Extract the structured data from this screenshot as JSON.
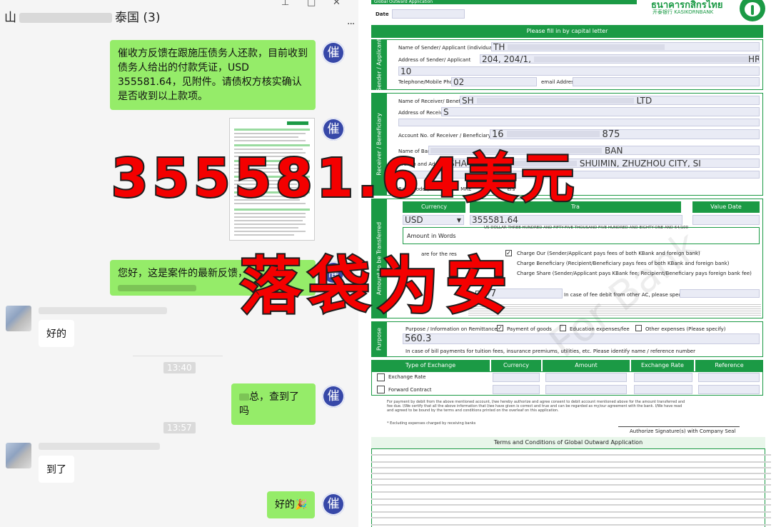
{
  "chat": {
    "title": "泰国 (3)",
    "title_prefix": "山",
    "window_controls": [
      "⊥",
      "□",
      "✕"
    ],
    "more_label": "...",
    "messages": [
      {
        "side": "out",
        "avatar": "催",
        "text": "催收方反馈在跟施压债务人还款，目前收到债务人给出的付款凭证，USD 355581.64，见附件。请债权方核实确认是否收到以上款项。"
      },
      {
        "side": "out",
        "avatar": "催",
        "type": "image"
      },
      {
        "side": "out",
        "avatar": "催",
        "text": "您好，这是案件的最新反馈，"
      },
      {
        "side": "in",
        "text": "好的"
      },
      {
        "side": "out",
        "avatar": "催",
        "text": "总，查到了吗"
      },
      {
        "side": "in",
        "text": "到了"
      },
      {
        "side": "out",
        "avatar": "催",
        "text": "好的🎉"
      }
    ],
    "timestamps": [
      "13:40",
      "13:57"
    ]
  },
  "form": {
    "header_title": "Global Outward Application",
    "bank_name_th": "ธนาคารกสิกรไทย",
    "bank_name_en": "开泰银行 KASIKORNBANK",
    "date_label": "Date",
    "instruction": "Please fill in by capital letter",
    "sender_section": "Sender / Applicant",
    "sender_name_label": "Name of Sender/ Applicant (individual/ juristic)",
    "sender_name_value": "TH",
    "sender_address_label": "Address of Sender/ Applicant",
    "sender_address_value": "204, 204/1,",
    "sender_address_extra": "HRA",
    "sender_address_line2": "10",
    "sender_phone_label": "Telephone/Mobile Phone",
    "sender_phone_value": "02",
    "email_label": "email Address",
    "receiver_section": "Receiver / Beneficiary",
    "receiver_name_label": "Name of Receiver/ Beneficiary",
    "receiver_name_value": "SH",
    "receiver_name_suffix": "LTD",
    "receiver_address_label": "Address of Receiver",
    "receiver_address_value": "S",
    "account_label": "Account No. of Receiver / Beneficiary / IBAN",
    "account_value_start": "16",
    "account_value_end": "875",
    "bank_label": "Name of Bank",
    "bank_value_end": "BAN",
    "branch_label": "Branch and Address of Bank",
    "branch_value": "SHA",
    "branch_value_end": "SHUIMIN, ZHUZHOU CITY, SI",
    "bank_code_label": "Bank Code (S",
    "bank_code_extra": "MRE",
    "bank_code_tail": "ers",
    "amount_section": "Amount to be Transferred",
    "currency_header": "Currency",
    "transfer_header": "Tra",
    "value_date_header": "Value Date",
    "currency_value": "USD",
    "amount_value": "355581.64",
    "amount_words_label": "Amount in Words",
    "amount_words_value": "US DOLLAR THREE HUNDRED AND FIFTY-FIVE THOUSAND FIVE HUNDRED AND EIGHTY-ONE AND 64/100",
    "charges_label": "are for the res",
    "charge_our": "Charge Our (Sender/Applicant pays fees of both KBank and foreign bank)",
    "charge_ben": "Charge Beneficiary (Recipient/Beneficiary pays fees of both KBank and foreign bank)",
    "charge_share": "Charge Share (Sender/Applicant pays KBank fee; Recipient/Beneficiary pays foreign bank fee)",
    "debit_account_value": "7",
    "debit_other_label": "In case of fee debit from other AC, please specify AC No.",
    "purpose_section": "Purpose",
    "purpose_label": "Purpose / Information on Remittance",
    "purpose_goods": "Payment of goods",
    "purpose_edu": "Education expenses/fee",
    "purpose_other": "Other expenses (Please specify)",
    "purpose_value": "560.3",
    "purpose_note": "In case of bill payments for tuition fees, insurance premiums, utilities, etc. Please identify name / reference number",
    "fx_headers": [
      "Type of Exchange",
      "Currency",
      "Amount",
      "Exchange Rate",
      "Reference"
    ],
    "fx_rows": [
      "Exchange Rate",
      "Forward Contract"
    ],
    "declaration": "For payment by debit from the above mentioned account, I/we hereby authorize and agree consent to debit account mentioned above for the amount transferred and fee due. I/We certify that all the above information that I/we have given is correct and true and can be regarded as my/our agreement with the bank. I/We have read and agreed to be bound by the terms and conditions printed on the overleaf on this application.",
    "excluding_note": "* Excluding expenses charged by receiving banks",
    "signature_label": "Authorize Signature(s) with Company Seal",
    "terms_title": "Terms and Conditions of Global Outward Application",
    "watermark": "For Bank"
  },
  "overlay": {
    "amount_text": "355581.64美元",
    "status_text": "落袋为安"
  },
  "colors": {
    "wechat_green": "#95ec69",
    "kbank_green": "#1b9a45",
    "overlay_red": "#f40000",
    "avatar_blue": "#3748a8"
  }
}
